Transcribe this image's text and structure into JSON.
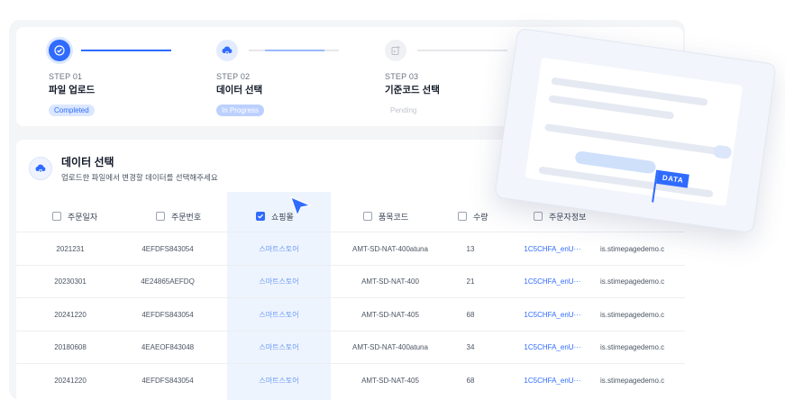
{
  "stepper": {
    "steps": [
      {
        "num": "STEP 01",
        "title": "파일 업로드",
        "status": "Completed"
      },
      {
        "num": "STEP 02",
        "title": "데이터 선택",
        "status": "In Progress"
      },
      {
        "num": "STEP 03",
        "title": "기준코드 선택",
        "status": "Pending"
      }
    ]
  },
  "panel": {
    "title": "데이터 선택",
    "subtitle": "업로드한 파일에서 변경할 데이터를 선택해주세요"
  },
  "table": {
    "columns": [
      "주문일자",
      "주문번호",
      "쇼핑몰",
      "품목코드",
      "수량",
      "주문자정보"
    ],
    "rows": [
      [
        "2021231",
        "4EFDFS843054",
        "스마트스토어",
        "AMT-SD-NAT-400atuna",
        "13",
        "1C5CHFA_enU···",
        "is.stimepagedemo.c"
      ],
      [
        "20230301",
        "4E24865AEFDQ",
        "스마트스토어",
        "AMT-SD-NAT-400",
        "21",
        "1C5CHFA_enU···",
        "is.stimepagedemo.c"
      ],
      [
        "20241220",
        "4EFDFS843054",
        "스마트스토어",
        "AMT-SD-NAT-405",
        "68",
        "1C5CHFA_enU···",
        "is.stimepagedemo.c"
      ],
      [
        "20180608",
        "4EAEOF843048",
        "스마트스토어",
        "AMT-SD-NAT-400atuna",
        "34",
        "1C5CHFA_enU···",
        "is.stimepagedemo.c"
      ],
      [
        "20241220",
        "4EFDFS843054",
        "스마트스토어",
        "AMT-SD-NAT-405",
        "68",
        "1C5CHFA_enU···",
        "is.stimepagedemo.c"
      ]
    ]
  },
  "float_card": {
    "flag_label": "DATA"
  },
  "colors": {
    "accent": "#2f6bff",
    "highlight": "#eef4fd"
  },
  "icons": [
    "check-icon",
    "cloud-upload-icon",
    "code-file-icon",
    "checkbox-icon",
    "cursor-pointer-icon",
    "flag-icon"
  ]
}
